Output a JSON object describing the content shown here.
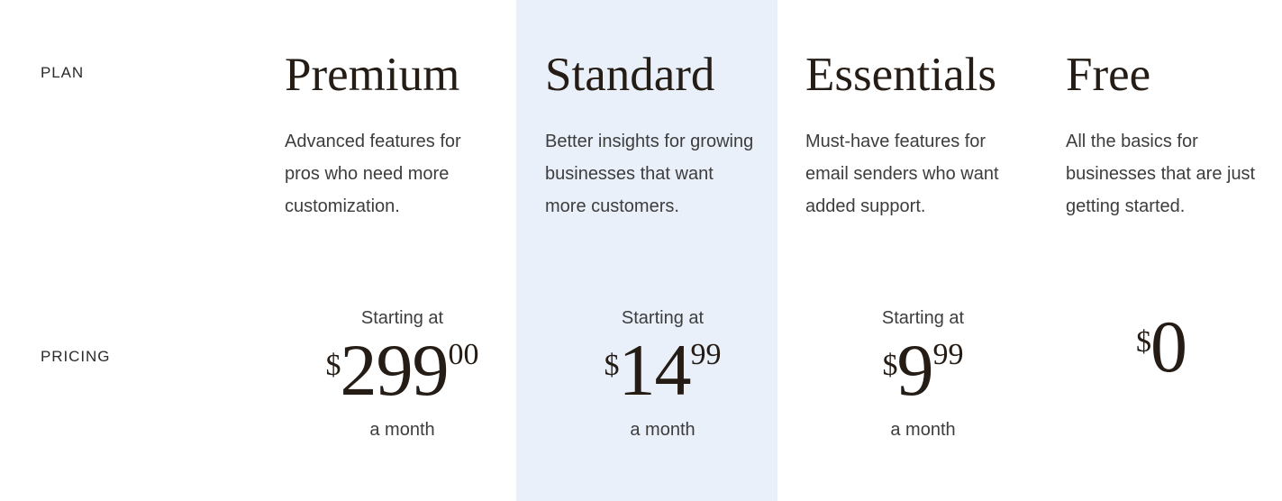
{
  "theme": {
    "page_background": "#ffffff",
    "highlight_background": "#e9f0fa",
    "heading_color": "#241c15",
    "body_text_color": "#3d3d3d",
    "label_color": "#2b2a28"
  },
  "rows": {
    "plan_label": "PLAN",
    "pricing_label": "PRICING"
  },
  "plans": [
    {
      "id": "premium",
      "name": "Premium",
      "description": "Advanced features for pros who need more customization.",
      "highlighted": false,
      "pricing": {
        "starting_at": "Starting at",
        "currency": "$",
        "whole": "299",
        "cents": "00",
        "period": "a month"
      }
    },
    {
      "id": "standard",
      "name": "Standard",
      "description": "Better insights for growing businesses that want more customers.",
      "highlighted": true,
      "pricing": {
        "starting_at": "Starting at",
        "currency": "$",
        "whole": "14",
        "cents": "99",
        "period": "a month"
      }
    },
    {
      "id": "essentials",
      "name": "Essentials",
      "description": "Must-have features for email senders who want added support.",
      "highlighted": false,
      "pricing": {
        "starting_at": "Starting at",
        "currency": "$",
        "whole": "9",
        "cents": "99",
        "period": "a month"
      }
    },
    {
      "id": "free",
      "name": "Free",
      "description": "All the basics for businesses that are just getting started.",
      "highlighted": false,
      "pricing": {
        "starting_at": "",
        "currency": "$",
        "whole": "0",
        "cents": "",
        "period": ""
      }
    }
  ]
}
